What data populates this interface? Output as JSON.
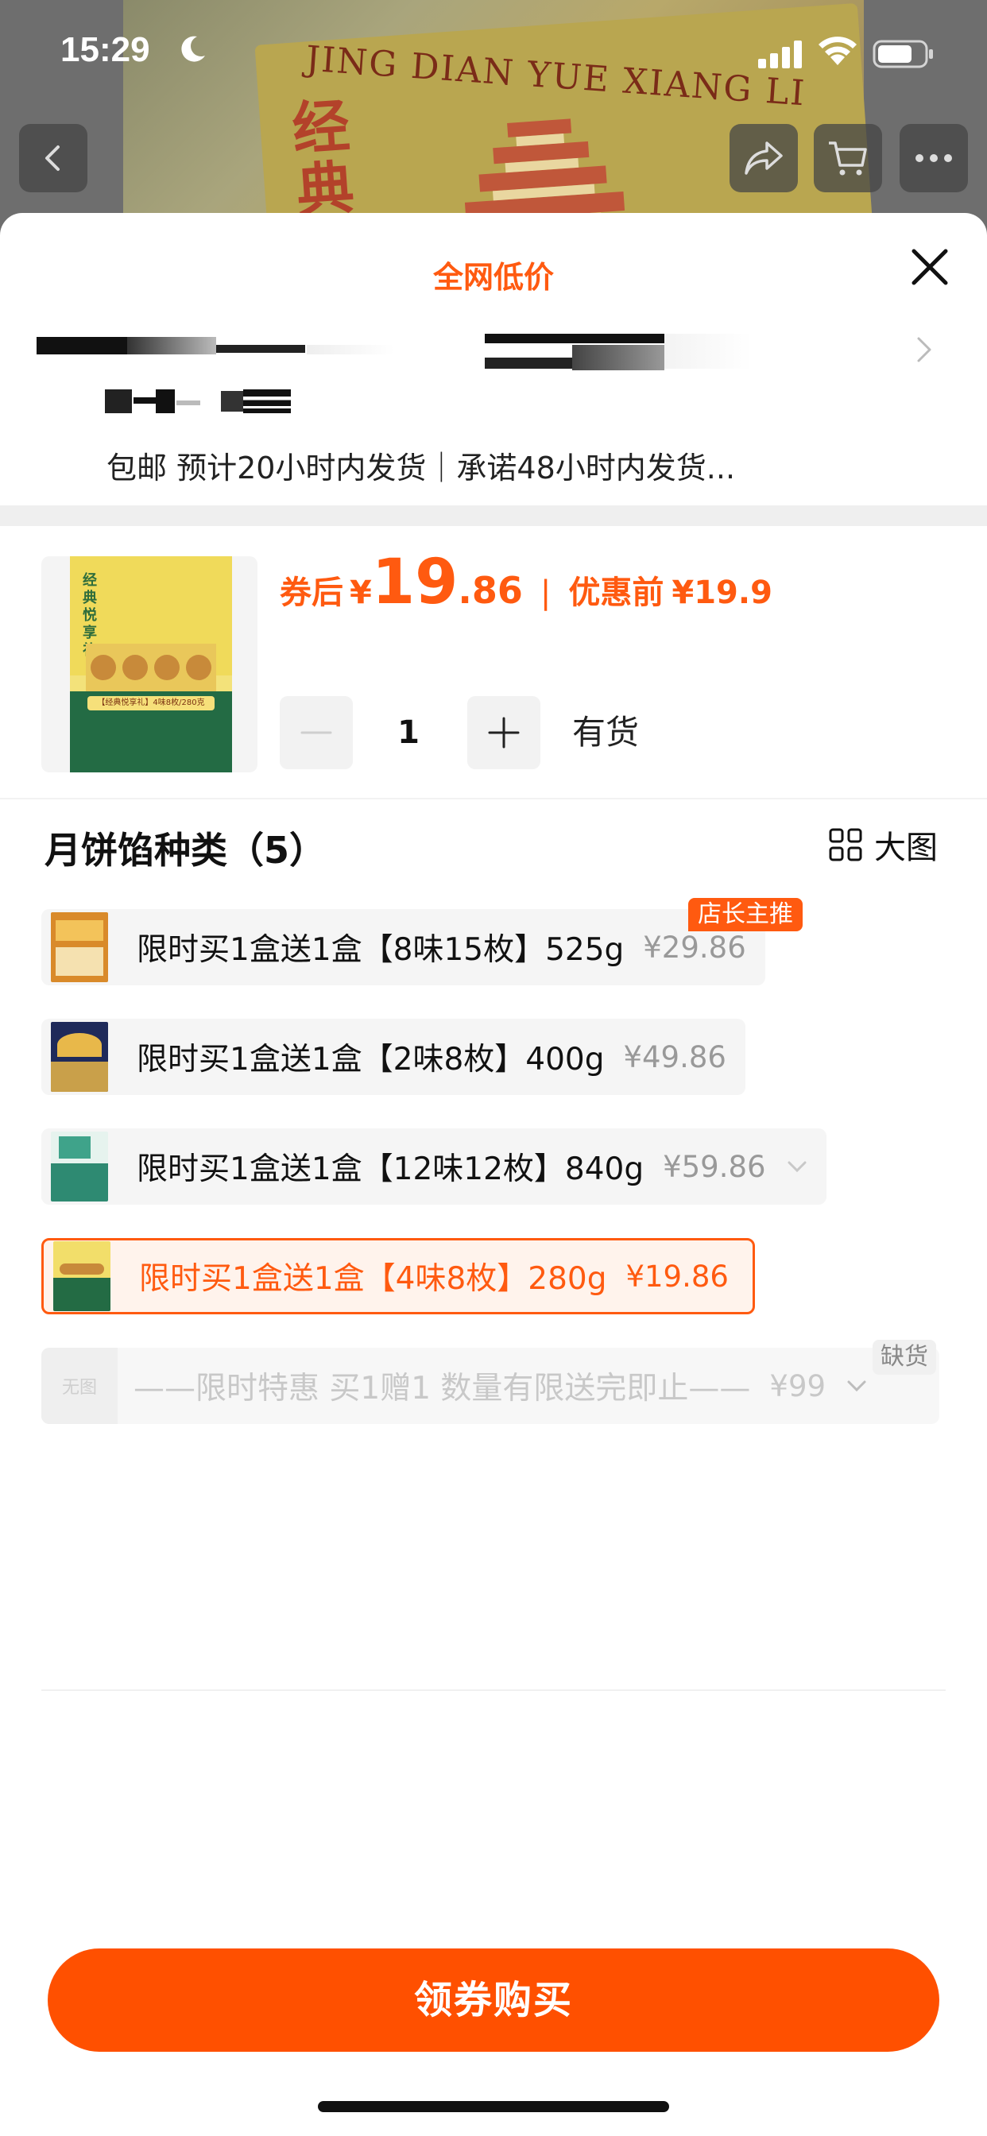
{
  "status_bar": {
    "time": "15:29"
  },
  "backdrop": {
    "box_slogan": "JING DIAN YUE XIANG LI",
    "box_title_cn": "经典悦"
  },
  "sheet": {
    "promo_title": "全网低价",
    "shipping_info": "包邮 预计20小时内发货｜承诺48小时内发货..."
  },
  "product": {
    "thumbnail": {
      "title": "经典悦享礼",
      "banner": "【经典悦享礼】4味8枚/280克"
    },
    "price_label": "券后",
    "currency": "¥",
    "price_int": "19",
    "price_dec": ".86",
    "separator": "|",
    "original_label": "优惠前",
    "original_price": "¥19.9",
    "quantity": "1",
    "stock_status": "有货"
  },
  "variants": {
    "section_title": "月饼馅种类（5）",
    "big_view_label": "大图",
    "items": [
      {
        "name": "限时买1盒送1盒【8味15枚】525g",
        "price": "¥29.86",
        "badge": "店长主推"
      },
      {
        "name": "限时买1盒送1盒【2味8枚】400g",
        "price": "¥49.86"
      },
      {
        "name": "限时买1盒送1盒【12味12枚】840g",
        "price": "¥59.86"
      },
      {
        "name": "限时买1盒送1盒【4味8枚】280g",
        "price": "¥19.86"
      },
      {
        "name": "——限时特惠 买1赠1 数量有限送完即止——",
        "price": "¥99",
        "no_image_label": "无图",
        "badge": "缺货"
      }
    ]
  },
  "footer": {
    "buy_button": "领券购买"
  },
  "colors": {
    "accent": "#ff5a10",
    "button": "#ff5000",
    "selected_bg": "#fff3ec",
    "muted": "#999999"
  }
}
